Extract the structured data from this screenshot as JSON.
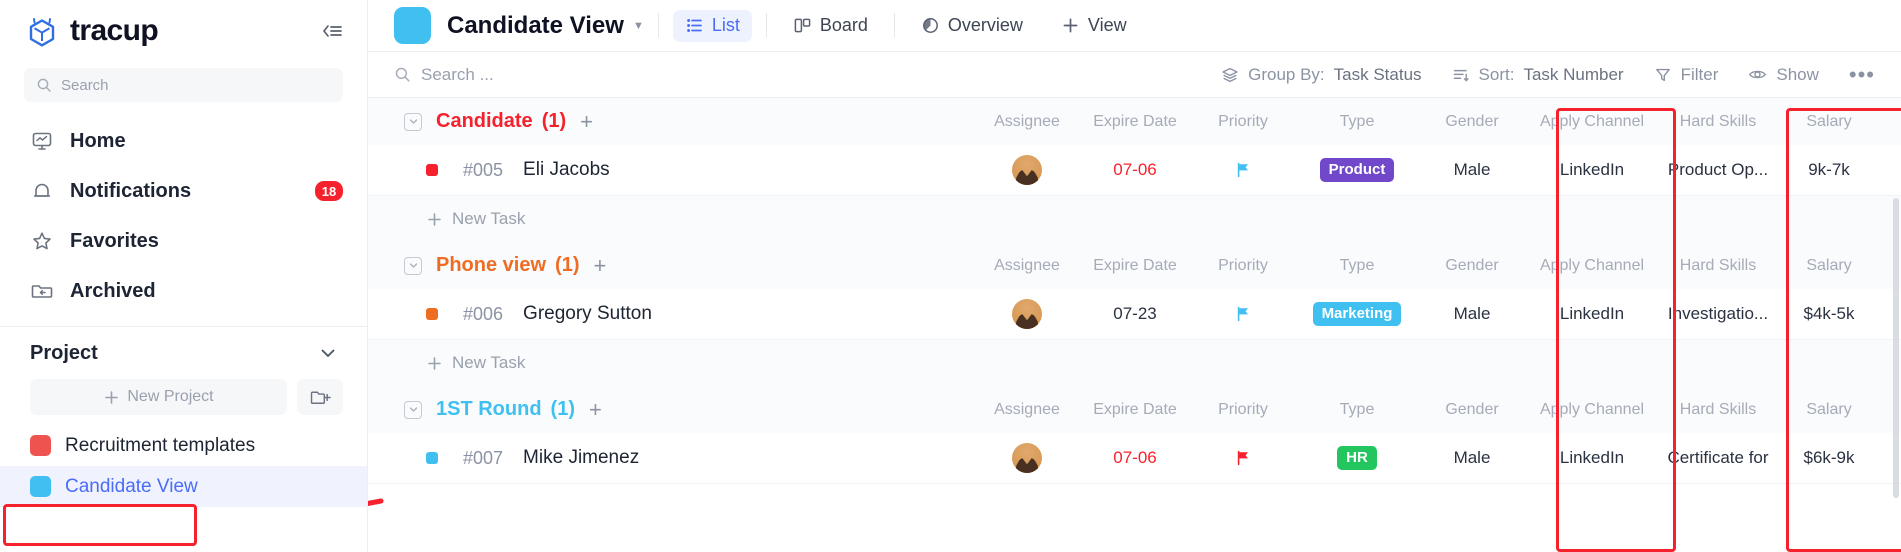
{
  "sidebar": {
    "brand": "tracup",
    "collapse_icon": "collapse-panel-icon",
    "search": {
      "placeholder": "Search",
      "icon": "search-icon"
    },
    "nav": [
      {
        "label": "Home",
        "icon": "dashboard-monitor-icon",
        "badge": ""
      },
      {
        "label": "Notifications",
        "icon": "bell-icon",
        "badge": "18"
      },
      {
        "label": "Favorites",
        "icon": "star-icon",
        "badge": ""
      },
      {
        "label": "Archived",
        "icon": "archive-folder-icon",
        "badge": ""
      }
    ],
    "project_section": {
      "title": "Project",
      "chevron_icon": "chevron-down-icon",
      "new_project_label": "New Project",
      "new_folder_icon": "new-folder-icon",
      "items": [
        {
          "label": "Recruitment templates",
          "color": "#ef5350",
          "active": false
        },
        {
          "label": "Candidate View",
          "color": "#3fc0f0",
          "active": true
        }
      ]
    }
  },
  "topbar": {
    "view_color": "#3fc0f0",
    "title": "Candidate View",
    "title_caret_icon": "chevron-down-icon",
    "tabs": [
      {
        "label": "List",
        "icon": "list-icon",
        "active": true
      },
      {
        "label": "Board",
        "icon": "board-icon",
        "active": false
      },
      {
        "label": "Overview",
        "icon": "pie-chart-icon",
        "active": false
      },
      {
        "label": "View",
        "icon": "plus-icon",
        "active": false
      }
    ]
  },
  "filterbar": {
    "search_placeholder": "Search ...",
    "search_icon": "search-icon",
    "group_by_label": "Group By:",
    "group_by_value": "Task Status",
    "group_by_icon": "layers-icon",
    "sort_label": "Sort:",
    "sort_value": "Task Number",
    "sort_icon": "sort-icon",
    "filter_label": "Filter",
    "filter_icon": "funnel-icon",
    "show_label": "Show",
    "show_icon": "eye-icon",
    "more_icon": "ellipsis-icon"
  },
  "columns": [
    "Assignee",
    "Expire Date",
    "Priority",
    "Type",
    "Gender",
    "Apply Channel",
    "Hard Skills",
    "Salary"
  ],
  "new_task_label": "New Task",
  "groups": [
    {
      "title": "Candidate",
      "count": "(1)",
      "color": "#f5222d",
      "add_icon": "plus-icon",
      "collapse_icon": "chevron-down-box-icon",
      "tasks": [
        {
          "dot_color": "#f5222d",
          "id": "#005",
          "name": "Eli Jacobs",
          "assignee_icon": "avatar",
          "expire_date": "07-06",
          "expire_urgent": true,
          "priority_icon": "flag-icon",
          "priority_color": "#3fc0f0",
          "type": "Product",
          "type_color": "#7048c9",
          "gender": "Male",
          "apply_channel": "LinkedIn",
          "hard_skills": "Product Op...",
          "salary": "9k-7k"
        }
      ]
    },
    {
      "title": "Phone view",
      "count": "(1)",
      "color": "#ef6c23",
      "add_icon": "plus-icon",
      "collapse_icon": "chevron-down-box-icon",
      "tasks": [
        {
          "dot_color": "#ef6c23",
          "id": "#006",
          "name": "Gregory Sutton",
          "assignee_icon": "avatar",
          "expire_date": "07-23",
          "expire_urgent": false,
          "priority_icon": "flag-icon",
          "priority_color": "#3fc0f0",
          "type": "Marketing",
          "type_color": "#3fc0f0",
          "gender": "Male",
          "apply_channel": "LinkedIn",
          "hard_skills": "Investigatio...",
          "salary": "$4k-5k"
        }
      ]
    },
    {
      "title": "1ST Round",
      "count": "(1)",
      "color": "#3fc0f0",
      "add_icon": "plus-icon",
      "collapse_icon": "chevron-down-box-icon",
      "tasks": [
        {
          "dot_color": "#3fc0f0",
          "id": "#007",
          "name": "Mike Jimenez",
          "assignee_icon": "avatar",
          "expire_date": "07-06",
          "expire_urgent": true,
          "priority_icon": "flag-icon",
          "priority_color": "#f5222d",
          "type": "HR",
          "type_color": "#22c55e",
          "gender": "Male",
          "apply_channel": "LinkedIn",
          "hard_skills": "Certificate for",
          "salary": "$6k-9k"
        }
      ]
    }
  ],
  "annotations": {
    "highlight_color": "#f5222d",
    "boxes": [
      "type-column-highlight",
      "apply-channel-column-highlight",
      "candidate-view-sidebar-highlight"
    ],
    "arrow": "red-arrow-pointing-to-candidate-view"
  }
}
